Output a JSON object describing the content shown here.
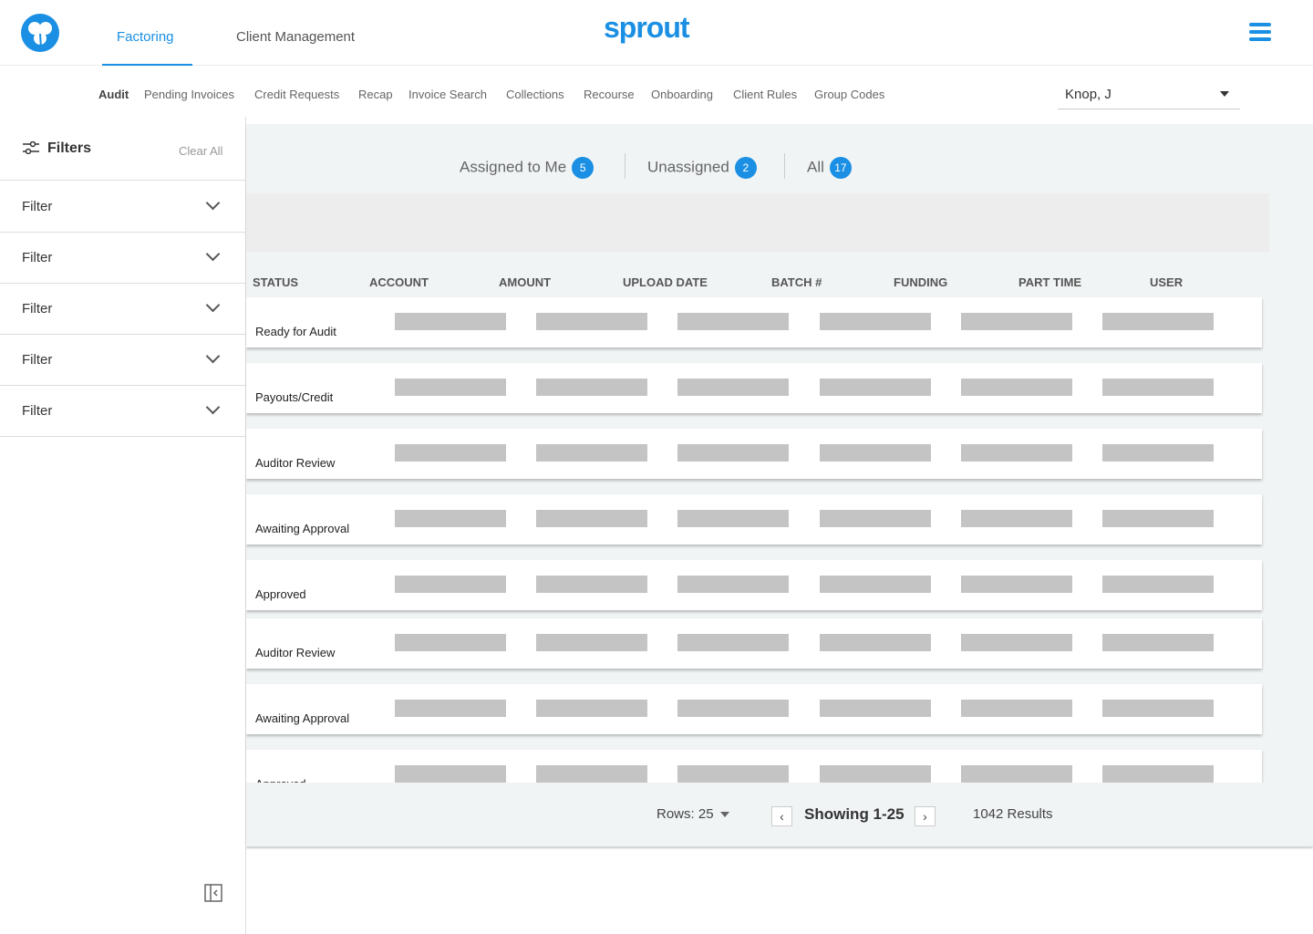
{
  "header": {
    "tabs": [
      {
        "label": "Factoring",
        "active": true
      },
      {
        "label": "Client Management",
        "active": false
      }
    ],
    "brand": "sprout"
  },
  "subnav": {
    "items": [
      "Audit",
      "Pending Invoices",
      "Credit Requests",
      "Recap",
      "Invoice Search",
      "Collections",
      "Recourse",
      "Onboarding",
      "Client Rules",
      "Group Codes"
    ],
    "active": "Audit",
    "user": "Knop, J"
  },
  "sidebar": {
    "title": "Filters",
    "clear_all": "Clear All",
    "filters": [
      "Filter",
      "Filter",
      "Filter",
      "Filter",
      "Filter"
    ]
  },
  "segments": [
    {
      "label": "Assigned to Me",
      "count": "5"
    },
    {
      "label": "Unassigned",
      "count": "2"
    },
    {
      "label": "All",
      "count": "17"
    }
  ],
  "table": {
    "columns": [
      "STATUS",
      "ACCOUNT",
      "AMOUNT",
      "UPLOAD DATE",
      "BATCH #",
      "FUNDING",
      "PART TIME",
      "USER"
    ],
    "rows": [
      "Ready for Audit",
      "Payouts/Credit",
      "Auditor Review",
      "Awaiting Approval",
      "Approved",
      "Auditor Review",
      "Awaiting Approval",
      "Approved"
    ]
  },
  "footer": {
    "rows_label": "Rows:",
    "rows_value": "25",
    "showing": "Showing 1-25",
    "results": "1042 Results"
  },
  "colors": {
    "accent": "#1a8fe3",
    "main_bg": "#f1f4f5",
    "placeholder": "#c4c4c4"
  }
}
